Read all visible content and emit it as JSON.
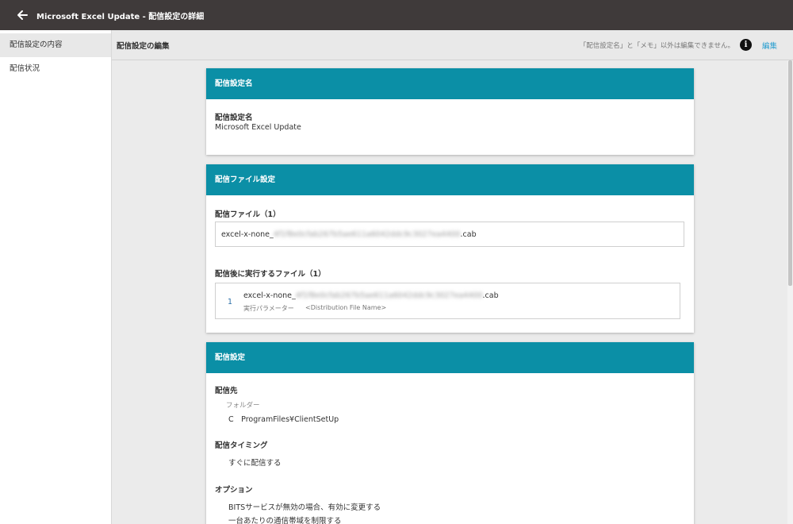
{
  "header": {
    "title": "Microsoft Excel Update - 配信設定の詳細"
  },
  "sidebar": {
    "items": [
      {
        "label": "配信設定の内容"
      },
      {
        "label": "配信状況"
      }
    ]
  },
  "subheader": {
    "title": "配信設定の編集",
    "note": "「配信設定名」と「メモ」以外は編集できません。",
    "edit_label": "編集"
  },
  "cards": {
    "name": {
      "header": "配信設定名",
      "field_label": "配信設定名",
      "field_value": "Microsoft Excel Update"
    },
    "file": {
      "header": "配信ファイル設定",
      "files_label": "配信ファイル（1）",
      "file_prefix": "excel-x-none_",
      "file_redacted": "4f1f8e0cfab267b5ae611a6042ddc9c3027ea4400",
      "file_suffix": ".cab",
      "post_exec_label": "配信後に実行するファイル（1）",
      "exec_index": "1",
      "exec_prefix": "excel-x-none_",
      "exec_redacted": "4f1f8e0cfab267b5ae611a6042ddc9c3027ea4400",
      "exec_suffix": ".cab",
      "param_label": "実行パラメーター",
      "param_value": "<Distribution File Name>"
    },
    "settings": {
      "header": "配信設定",
      "dest_label": "配信先",
      "folder_label": "フォルダー",
      "folder_value": "C　ProgramFiles¥ClientSetUp",
      "timing_label": "配信タイミング",
      "timing_value": "すぐに配信する",
      "options_label": "オプション",
      "options": [
        "BITSサービスが無効の場合、有効に変更する",
        "一台あたりの通信帯域を制限する"
      ]
    }
  }
}
